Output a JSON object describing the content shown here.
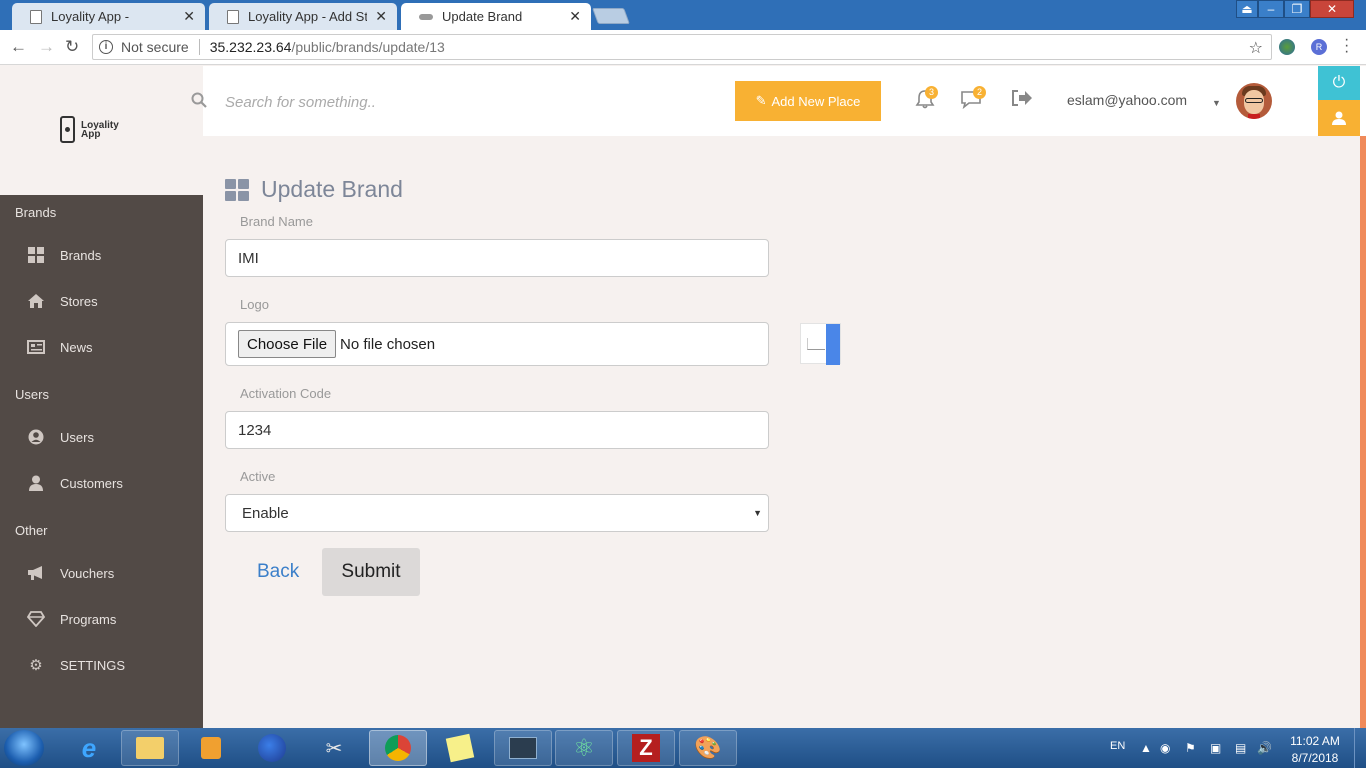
{
  "browser": {
    "tabs": [
      {
        "title": "Loyality App -",
        "active": false
      },
      {
        "title": "Loyality App - Add Stores",
        "active": false
      },
      {
        "title": "Update Brand",
        "active": true
      }
    ],
    "address": {
      "security_label": "Not secure",
      "host": "35.232.23.64",
      "path": "/public/brands/update/13"
    }
  },
  "sidebar": {
    "logo_line1": "Loyality",
    "logo_line2": "App",
    "sections": [
      {
        "label": "Brands",
        "items": [
          {
            "label": "Brands",
            "icon": "grid-icon"
          },
          {
            "label": "Stores",
            "icon": "home-icon"
          },
          {
            "label": "News",
            "icon": "newspaper-icon"
          }
        ]
      },
      {
        "label": "Users",
        "items": [
          {
            "label": "Users",
            "icon": "user-circle-icon"
          },
          {
            "label": "Customers",
            "icon": "user-icon"
          }
        ]
      },
      {
        "label": "Other",
        "items": [
          {
            "label": "Vouchers",
            "icon": "megaphone-icon"
          },
          {
            "label": "Programs",
            "icon": "diamond-icon"
          },
          {
            "label": "SETTINGS",
            "icon": "gear-icon"
          }
        ]
      }
    ]
  },
  "topbar": {
    "search_placeholder": "Search for something..",
    "add_button": "Add New Place",
    "notifications_count": "3",
    "messages_count": "2",
    "user_email": "eslam@yahoo.com"
  },
  "form": {
    "title": "Update Brand",
    "brand_name_label": "Brand Name",
    "brand_name_value": "IMI",
    "logo_label": "Logo",
    "choose_file_label": "Choose File",
    "file_status": "No file chosen",
    "activation_code_label": "Activation Code",
    "activation_code_value": "1234",
    "active_label": "Active",
    "active_value": "Enable",
    "back_label": "Back",
    "submit_label": "Submit"
  },
  "taskbar": {
    "language": "EN",
    "time": "11:02 AM",
    "date": "8/7/2018"
  },
  "colors": {
    "accent_orange": "#f8b133",
    "accent_cyan": "#3fc2d4",
    "sidebar_bg": "#524a46",
    "page_bg": "#f6f1ef",
    "link_blue": "#3b7fc9"
  }
}
